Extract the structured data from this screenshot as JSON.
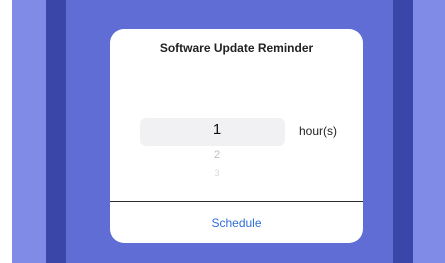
{
  "dialog": {
    "title": "Software Update Reminder",
    "picker": {
      "selected_value": "1",
      "next_values": [
        "2",
        "3"
      ],
      "unit_label": "hour(s)"
    },
    "schedule_label": "Schedule"
  },
  "colors": {
    "background": "#5d6bd2",
    "accent": "#2f6fd8"
  }
}
